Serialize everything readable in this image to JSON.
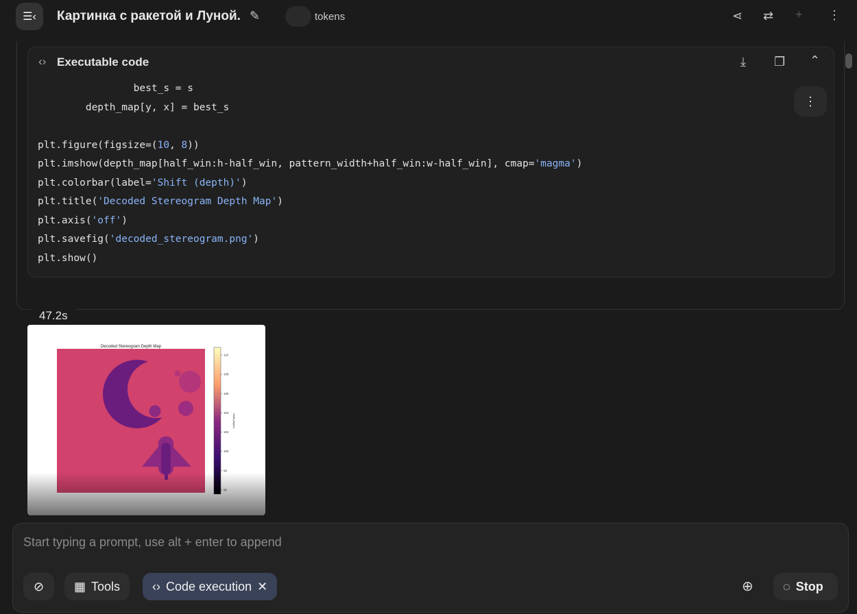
{
  "header": {
    "title": "Картинка с ракетой и Луной.",
    "tokens_label": "tokens"
  },
  "code_block": {
    "label": "Executable code",
    "lines": [
      [
        {
          "t": "                best_s = s"
        }
      ],
      [
        {
          "t": "        depth_map[y, x] = best_s"
        }
      ],
      [
        {
          "t": ""
        }
      ],
      [
        {
          "t": "plt.figure(figsize=("
        },
        {
          "t": "10",
          "s": 1
        },
        {
          "t": ", "
        },
        {
          "t": "8",
          "s": 1
        },
        {
          "t": "))"
        }
      ],
      [
        {
          "t": "plt.imshow(depth_map[half_win:h-half_win, pattern_width+half_win:w-half_win], cmap="
        },
        {
          "t": "'magma'",
          "s": 1
        },
        {
          "t": ")"
        }
      ],
      [
        {
          "t": "plt.colorbar(label="
        },
        {
          "t": "'Shift (depth)'",
          "s": 1
        },
        {
          "t": ")"
        }
      ],
      [
        {
          "t": "plt.title("
        },
        {
          "t": "'Decoded Stereogram Depth Map'",
          "s": 1
        },
        {
          "t": ")"
        }
      ],
      [
        {
          "t": "plt.axis("
        },
        {
          "t": "'off'",
          "s": 1
        },
        {
          "t": ")"
        }
      ],
      [
        {
          "t": "plt.savefig("
        },
        {
          "t": "'decoded_stereogram.png'",
          "s": 1
        },
        {
          "t": ")"
        }
      ],
      [
        {
          "t": "plt.show()"
        }
      ]
    ]
  },
  "result": {
    "duration": "47.2s",
    "figure": {
      "title": "Decoded Stereogram Depth Map",
      "colorbar_label": "Shift (depth)",
      "colorbar_ticks": [
        "110",
        "108",
        "106",
        "104",
        "102",
        "100",
        "98",
        "96"
      ],
      "cmap": "magma"
    }
  },
  "input": {
    "placeholder": "Start typing a prompt, use alt + enter to append",
    "tools_label": "Tools",
    "code_exec_label": "Code execution",
    "stop_label": "Stop"
  }
}
